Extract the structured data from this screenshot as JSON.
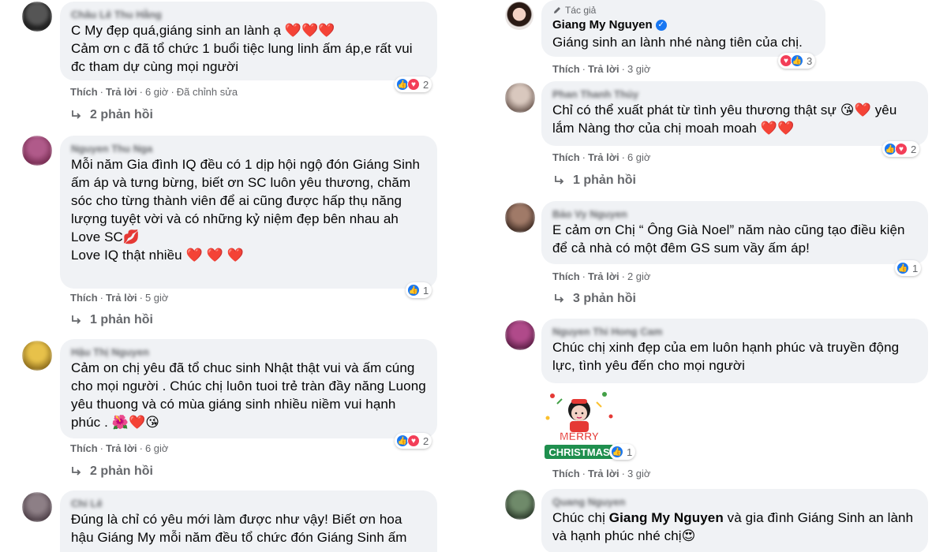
{
  "labels": {
    "like": "Thích",
    "reply": "Trả lời",
    "edited": "Đã chỉnh sửa",
    "author_tag": "Tác giả",
    "sticker_text_1": "MERRY",
    "sticker_text_2": "CHRISTMAS"
  },
  "left_comments": [
    {
      "author": "Châu Lê Thu Hằng",
      "text": "C My đẹp quá,giáng sinh an lành ạ ❤️❤️❤️\nCảm ơn c đã tổ chức 1 buổi tiệc lung linh ấm áp,e rất vui đc tham dự cùng mọi người",
      "time": "6 giờ",
      "reactions": "2",
      "replies": "2 phản hồi"
    },
    {
      "author": "Nguyen Thu Nga",
      "text": "Mỗi năm Gia đình IQ đều có 1 dịp hội ngộ đón Giáng Sinh ấm áp và tưng bừng, biết ơn SC luôn yêu thương, chăm sóc cho từng thành viên để ai cũng được hấp thụ năng lượng tuyệt vời và có những kỷ niệm đẹp bên nhau ah\nLove SC💋\nLove IQ thật nhiều ❤️ ❤️ ❤️",
      "time": "5 giờ",
      "reactions": "1",
      "replies": "1 phản hồi"
    },
    {
      "author": "Hậu Thị Nguyen",
      "text": "Cảm on chị yêu đã tổ chuc sinh Nhật thật vui và ấm cúng cho mọi người . Chúc chị luôn tuoi trẻ tràn đầy năng Luong yêu thuong và có mùa giáng sinh nhiều niềm vui hạnh phúc . 🌺❤️😘",
      "time": "6 giờ",
      "reactions": "2",
      "replies": "2 phản hồi"
    },
    {
      "author": "Chi Lê",
      "text": "Đúng là chỉ có yêu mới làm được như vậy! Biết ơn hoa hậu Giáng My mỗi năm đều tổ chức đón Giáng Sinh ấm"
    }
  ],
  "right_comments": [
    {
      "author": "Giang My Nguyen",
      "text": "Giáng sinh an lành nhé nàng tiên của chị.",
      "time": "3 giờ",
      "reactions": "3"
    },
    {
      "author": "Phan Thanh Thúy",
      "text": "Chỉ có thể xuất phát từ tình yêu thương thật sự 😘❤️ yêu lắm Nàng thơ của chị moah moah ❤️❤️",
      "time": "6 giờ",
      "reactions": "2",
      "replies": "1 phản hồi"
    },
    {
      "author": "Bảo Vy Nguyen",
      "text": "E cảm ơn Chị “ Ông Già Noel” năm nào cũng tạo điều kiện để cả nhà có một đêm GS sum vầy ấm áp!",
      "time": "2 giờ",
      "reactions": "1",
      "replies": "3 phản hồi"
    },
    {
      "author": "Nguyen Thi Hong Cam",
      "text": "Chúc chị xinh đẹp của em luôn hạnh phúc và truyền động lực, tình yêu đến cho mọi người",
      "time": "3 giờ",
      "reactions": "1"
    },
    {
      "author": "Quang Nguyen",
      "text_before": "Chúc chị ",
      "text_mention": "Giang My Nguyen",
      "text_after": " và gia đình Giáng Sinh an lành và hạnh phúc nhé chị😍"
    }
  ],
  "colors": {
    "bubble": "#f0f2f5",
    "like": "#1877f2",
    "love": "#f33e58",
    "meta": "#65676b"
  }
}
